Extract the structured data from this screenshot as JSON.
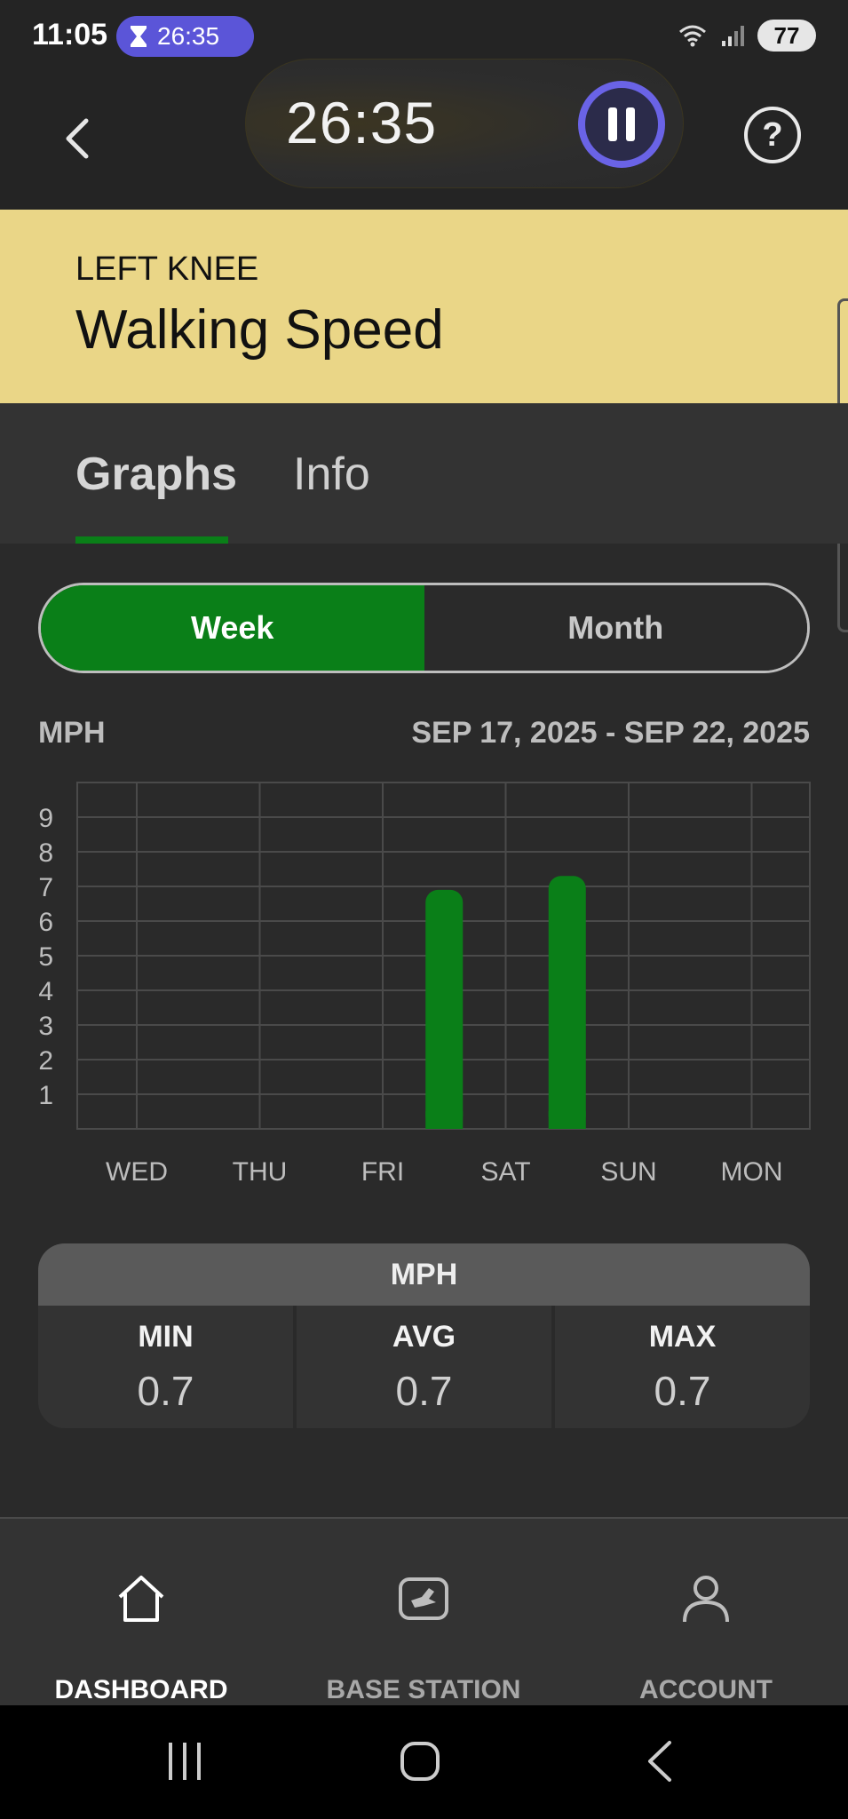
{
  "status_bar": {
    "time": "11:05",
    "timer_chip": "26:35",
    "battery": "77"
  },
  "header": {
    "timer": "26:35",
    "help_label": "?"
  },
  "title_block": {
    "subtitle": "LEFT KNEE",
    "title": "Walking Speed"
  },
  "tabs": [
    {
      "label": "Graphs",
      "active": true
    },
    {
      "label": "Info",
      "active": false
    }
  ],
  "segment": {
    "options": [
      "Week",
      "Month"
    ],
    "selected": "Week"
  },
  "chart_header": {
    "unit": "MPH",
    "range": "SEP 17, 2025 - SEP 22, 2025"
  },
  "chart_data": {
    "type": "bar",
    "categories": [
      "WED",
      "THU",
      "FRI",
      "SAT",
      "SUN",
      "MON"
    ],
    "values": [
      0,
      0,
      6.9,
      7.3,
      0,
      0
    ],
    "ylabel": "MPH",
    "yticks": [
      1,
      2,
      3,
      4,
      5,
      6,
      7,
      8,
      9
    ],
    "ylim": [
      0,
      10
    ],
    "grid": true,
    "bar_color": "#0a7f18"
  },
  "stats": {
    "header": "MPH",
    "items": [
      {
        "label": "MIN",
        "value": "0.7"
      },
      {
        "label": "AVG",
        "value": "0.7"
      },
      {
        "label": "MAX",
        "value": "0.7"
      }
    ]
  },
  "bottom_nav": {
    "items": [
      {
        "label": "DASHBOARD",
        "icon": "home-icon",
        "active": true
      },
      {
        "label": "BASE STATION",
        "icon": "base-station-icon",
        "active": false
      },
      {
        "label": "ACCOUNT",
        "icon": "user-icon",
        "active": false
      }
    ]
  },
  "colors": {
    "accent_green": "#0a7f18",
    "title_yellow": "#ead687",
    "pause_purple": "#6a63e6"
  }
}
